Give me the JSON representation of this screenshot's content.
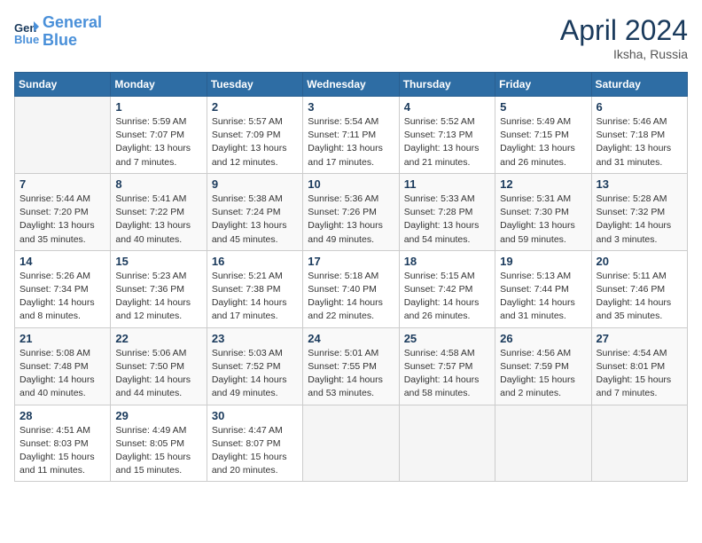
{
  "header": {
    "logo_line1": "General",
    "logo_line2": "Blue",
    "month_title": "April 2024",
    "location": "Iksha, Russia"
  },
  "columns": [
    "Sunday",
    "Monday",
    "Tuesday",
    "Wednesday",
    "Thursday",
    "Friday",
    "Saturday"
  ],
  "weeks": [
    [
      {
        "day": "",
        "info": ""
      },
      {
        "day": "1",
        "info": "Sunrise: 5:59 AM\nSunset: 7:07 PM\nDaylight: 13 hours\nand 7 minutes."
      },
      {
        "day": "2",
        "info": "Sunrise: 5:57 AM\nSunset: 7:09 PM\nDaylight: 13 hours\nand 12 minutes."
      },
      {
        "day": "3",
        "info": "Sunrise: 5:54 AM\nSunset: 7:11 PM\nDaylight: 13 hours\nand 17 minutes."
      },
      {
        "day": "4",
        "info": "Sunrise: 5:52 AM\nSunset: 7:13 PM\nDaylight: 13 hours\nand 21 minutes."
      },
      {
        "day": "5",
        "info": "Sunrise: 5:49 AM\nSunset: 7:15 PM\nDaylight: 13 hours\nand 26 minutes."
      },
      {
        "day": "6",
        "info": "Sunrise: 5:46 AM\nSunset: 7:18 PM\nDaylight: 13 hours\nand 31 minutes."
      }
    ],
    [
      {
        "day": "7",
        "info": "Sunrise: 5:44 AM\nSunset: 7:20 PM\nDaylight: 13 hours\nand 35 minutes."
      },
      {
        "day": "8",
        "info": "Sunrise: 5:41 AM\nSunset: 7:22 PM\nDaylight: 13 hours\nand 40 minutes."
      },
      {
        "day": "9",
        "info": "Sunrise: 5:38 AM\nSunset: 7:24 PM\nDaylight: 13 hours\nand 45 minutes."
      },
      {
        "day": "10",
        "info": "Sunrise: 5:36 AM\nSunset: 7:26 PM\nDaylight: 13 hours\nand 49 minutes."
      },
      {
        "day": "11",
        "info": "Sunrise: 5:33 AM\nSunset: 7:28 PM\nDaylight: 13 hours\nand 54 minutes."
      },
      {
        "day": "12",
        "info": "Sunrise: 5:31 AM\nSunset: 7:30 PM\nDaylight: 13 hours\nand 59 minutes."
      },
      {
        "day": "13",
        "info": "Sunrise: 5:28 AM\nSunset: 7:32 PM\nDaylight: 14 hours\nand 3 minutes."
      }
    ],
    [
      {
        "day": "14",
        "info": "Sunrise: 5:26 AM\nSunset: 7:34 PM\nDaylight: 14 hours\nand 8 minutes."
      },
      {
        "day": "15",
        "info": "Sunrise: 5:23 AM\nSunset: 7:36 PM\nDaylight: 14 hours\nand 12 minutes."
      },
      {
        "day": "16",
        "info": "Sunrise: 5:21 AM\nSunset: 7:38 PM\nDaylight: 14 hours\nand 17 minutes."
      },
      {
        "day": "17",
        "info": "Sunrise: 5:18 AM\nSunset: 7:40 PM\nDaylight: 14 hours\nand 22 minutes."
      },
      {
        "day": "18",
        "info": "Sunrise: 5:15 AM\nSunset: 7:42 PM\nDaylight: 14 hours\nand 26 minutes."
      },
      {
        "day": "19",
        "info": "Sunrise: 5:13 AM\nSunset: 7:44 PM\nDaylight: 14 hours\nand 31 minutes."
      },
      {
        "day": "20",
        "info": "Sunrise: 5:11 AM\nSunset: 7:46 PM\nDaylight: 14 hours\nand 35 minutes."
      }
    ],
    [
      {
        "day": "21",
        "info": "Sunrise: 5:08 AM\nSunset: 7:48 PM\nDaylight: 14 hours\nand 40 minutes."
      },
      {
        "day": "22",
        "info": "Sunrise: 5:06 AM\nSunset: 7:50 PM\nDaylight: 14 hours\nand 44 minutes."
      },
      {
        "day": "23",
        "info": "Sunrise: 5:03 AM\nSunset: 7:52 PM\nDaylight: 14 hours\nand 49 minutes."
      },
      {
        "day": "24",
        "info": "Sunrise: 5:01 AM\nSunset: 7:55 PM\nDaylight: 14 hours\nand 53 minutes."
      },
      {
        "day": "25",
        "info": "Sunrise: 4:58 AM\nSunset: 7:57 PM\nDaylight: 14 hours\nand 58 minutes."
      },
      {
        "day": "26",
        "info": "Sunrise: 4:56 AM\nSunset: 7:59 PM\nDaylight: 15 hours\nand 2 minutes."
      },
      {
        "day": "27",
        "info": "Sunrise: 4:54 AM\nSunset: 8:01 PM\nDaylight: 15 hours\nand 7 minutes."
      }
    ],
    [
      {
        "day": "28",
        "info": "Sunrise: 4:51 AM\nSunset: 8:03 PM\nDaylight: 15 hours\nand 11 minutes."
      },
      {
        "day": "29",
        "info": "Sunrise: 4:49 AM\nSunset: 8:05 PM\nDaylight: 15 hours\nand 15 minutes."
      },
      {
        "day": "30",
        "info": "Sunrise: 4:47 AM\nSunset: 8:07 PM\nDaylight: 15 hours\nand 20 minutes."
      },
      {
        "day": "",
        "info": ""
      },
      {
        "day": "",
        "info": ""
      },
      {
        "day": "",
        "info": ""
      },
      {
        "day": "",
        "info": ""
      }
    ]
  ]
}
